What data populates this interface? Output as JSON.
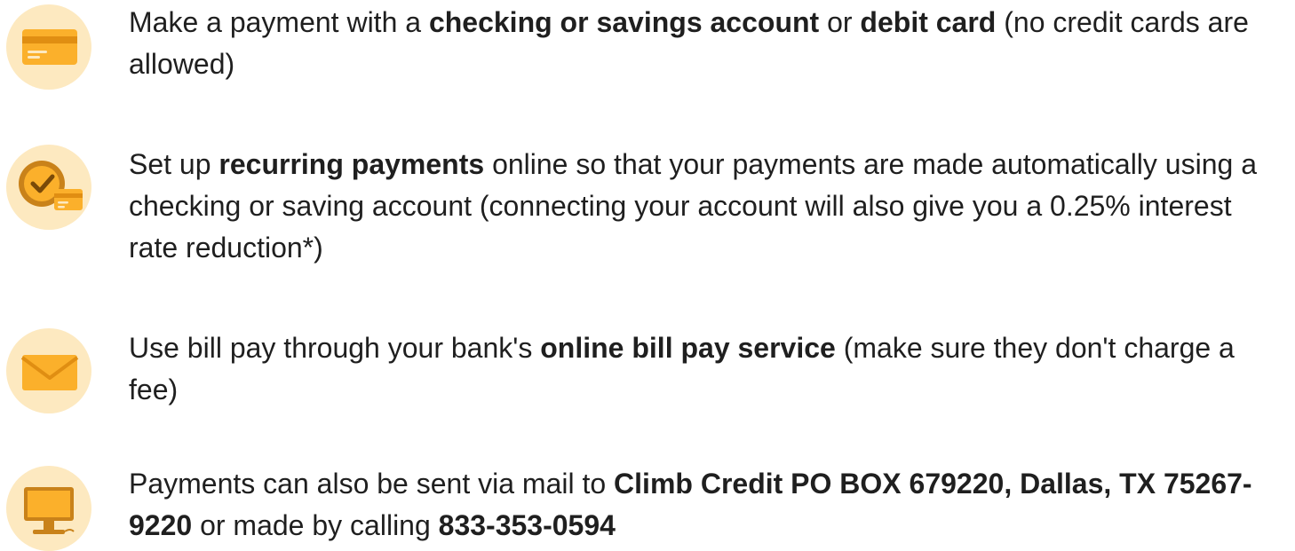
{
  "colors": {
    "icon_bg": "#fde9c0",
    "icon_primary": "#fbb02b",
    "icon_dark": "#c9821a",
    "text": "#1f1f1f"
  },
  "items": [
    {
      "icon": "credit-card-icon",
      "t1": "Make a payment with a ",
      "b1": "checking or savings account",
      "t2": " or ",
      "b2": "debit card",
      "t3": " (no credit cards are allowed)"
    },
    {
      "icon": "clock-card-icon",
      "t1": "Set up ",
      "b1": "recurring payments",
      "t2": " online so that your payments are made automatically using a checking or saving account (connecting your account will also give you a 0.25% interest rate reduction*)"
    },
    {
      "icon": "envelope-icon",
      "t1": "Use bill pay through your bank's ",
      "b1": "online bill pay service",
      "t2": " (make sure they don't charge a fee)"
    },
    {
      "icon": "computer-monitor-icon",
      "t1": "Payments can also be sent via mail to ",
      "b1": "Climb Credit PO BOX 679220, Dallas, TX 75267-9220",
      "t2": " or made by calling ",
      "b2": "833-353-0594"
    }
  ]
}
